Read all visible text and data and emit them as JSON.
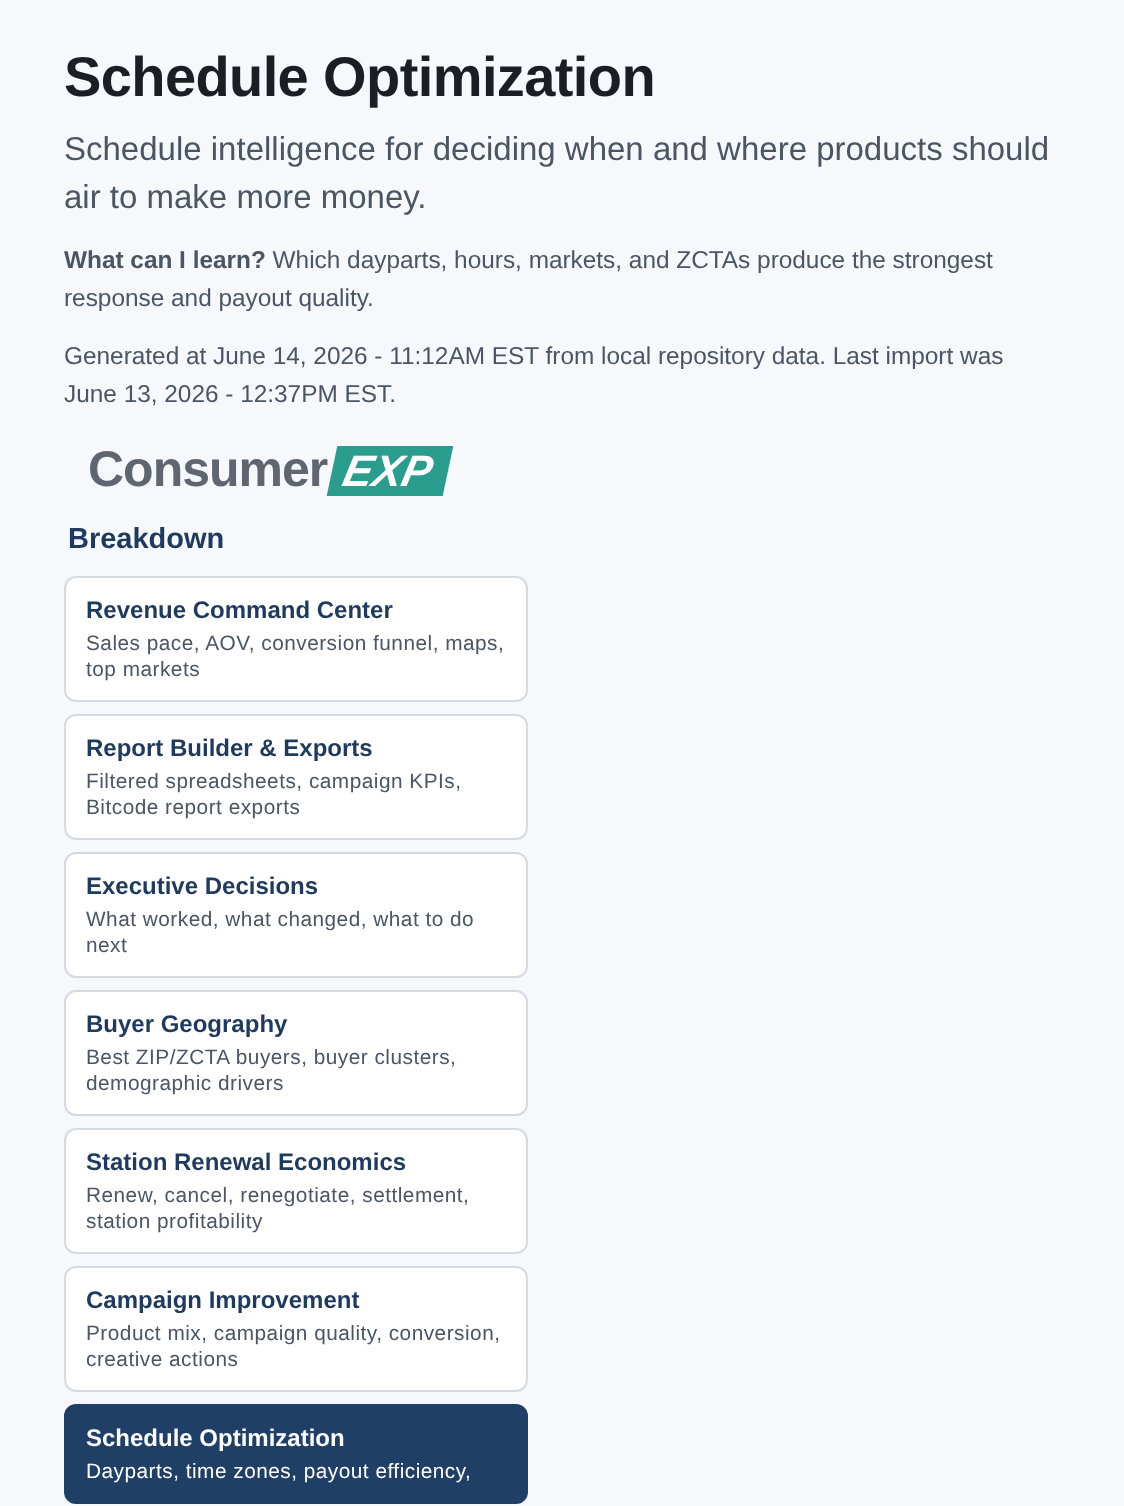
{
  "header": {
    "title": "Schedule Optimization",
    "subtitle": "Schedule intelligence for deciding when and where products should air to make more money.",
    "question": "**What can I learn?** Which dayparts, hours, markets, and ZCTAs produce the strongest response and payout quality.",
    "generated": "Generated at June 14, 2026 - 11:12AM EST from local repository data. Last import was June 13, 2026 - 12:37PM EST."
  },
  "logo": {
    "word": "Consumer",
    "badge": "EXP"
  },
  "breakdown": {
    "heading": "Breakdown",
    "items": [
      {
        "title": "Revenue Command Center",
        "description": "Sales pace, AOV, conversion funnel, maps, top markets",
        "selected": false
      },
      {
        "title": "Report Builder & Exports",
        "description": "Filtered spreadsheets, campaign KPIs, Bitcode report exports",
        "selected": false
      },
      {
        "title": "Executive Decisions",
        "description": "What worked, what changed, what to do next",
        "selected": false
      },
      {
        "title": "Buyer Geography",
        "description": "Best ZIP/ZCTA buyers, buyer clusters, demographic drivers",
        "selected": false
      },
      {
        "title": "Station Renewal Economics",
        "description": "Renew, cancel, renegotiate, settlement, station profitability",
        "selected": false
      },
      {
        "title": "Campaign Improvement",
        "description": "Product mix, campaign quality, conversion, creative actions",
        "selected": false
      },
      {
        "title": "Schedule Optimization",
        "description": "Dayparts, time zones, payout efficiency,",
        "selected": true
      }
    ]
  }
}
